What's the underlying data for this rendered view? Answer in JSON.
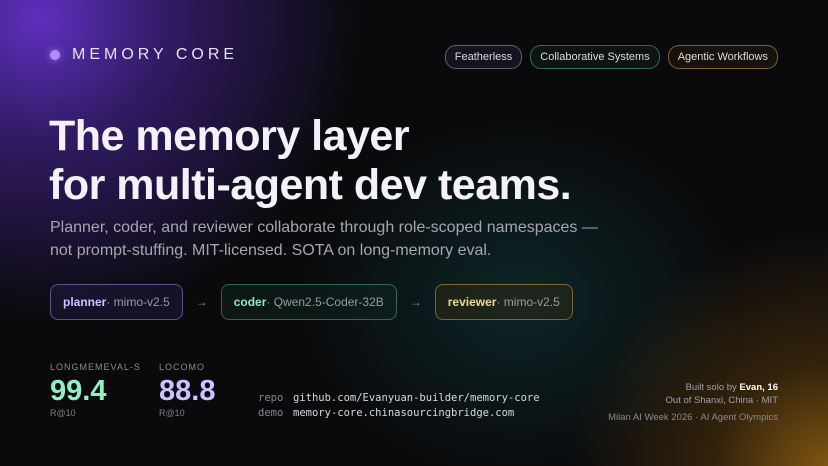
{
  "brand": {
    "name": "MEMORY CORE"
  },
  "tags": [
    "Featherless",
    "Collaborative Systems",
    "Agentic Workflows"
  ],
  "headline": {
    "line1": "The memory layer",
    "line2": "for multi-agent dev teams."
  },
  "subtitle": "Planner, coder, and reviewer collaborate through role-scoped namespaces — not prompt-stuffing. MIT-licensed. SOTA on long-memory eval.",
  "pipeline": {
    "arrow": "→",
    "agents": [
      {
        "role": "planner",
        "model": " · mimo-v2.5"
      },
      {
        "role": "coder",
        "model": " · Qwen2.5-Coder-32B"
      },
      {
        "role": "reviewer",
        "model": " · mimo-v2.5"
      }
    ]
  },
  "metrics": [
    {
      "label": "LONGMEMEVAL-S",
      "value": "99.4",
      "sub": "R@10"
    },
    {
      "label": "LOCOMO",
      "value": "88.8",
      "sub": "R@10"
    }
  ],
  "links": [
    {
      "key": "repo",
      "value": "github.com/Evanyuan-builder/memory-core"
    },
    {
      "key": "demo",
      "value": "memory-core.chinasourcingbridge.com"
    }
  ],
  "credits": {
    "built_prefix": "Built solo by ",
    "author": "Evan, 16",
    "origin": "Out of Shanxi, China · MIT",
    "event": "Milan AI Week 2026 · AI Agent Olympics"
  },
  "colors": {
    "accent_purple": "#b08cff",
    "planner": "#c9c6ff",
    "coder": "#8fe8c4",
    "reviewer": "#f2d78a",
    "metric_green": "#8ff0c4",
    "metric_purple": "#cbc3ff"
  }
}
